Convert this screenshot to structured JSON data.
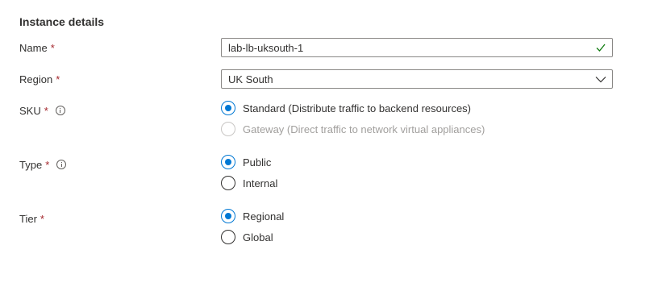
{
  "section": {
    "title": "Instance details"
  },
  "required_marker": "*",
  "name_field": {
    "label": "Name",
    "value": "lab-lb-uksouth-1",
    "valid_icon": "checkmark-icon",
    "valid_color": "#107c10"
  },
  "region_field": {
    "label": "Region",
    "selected": "UK South",
    "icon": "chevron-down-icon"
  },
  "sku_field": {
    "label": "SKU",
    "info_icon": "info-icon",
    "options": [
      {
        "label": "Standard (Distribute traffic to backend resources)",
        "checked": true,
        "disabled": false
      },
      {
        "label": "Gateway (Direct traffic to network virtual appliances)",
        "checked": false,
        "disabled": true
      }
    ]
  },
  "type_field": {
    "label": "Type",
    "info_icon": "info-icon",
    "options": [
      {
        "label": "Public",
        "checked": true,
        "disabled": false
      },
      {
        "label": "Internal",
        "checked": false,
        "disabled": false
      }
    ]
  },
  "tier_field": {
    "label": "Tier",
    "options": [
      {
        "label": "Regional",
        "checked": true,
        "disabled": false
      },
      {
        "label": "Global",
        "checked": false,
        "disabled": false
      }
    ]
  },
  "colors": {
    "accent": "#0078d4",
    "required": "#a4262c",
    "text": "#323130",
    "disabled_text": "#a19f9d",
    "border": "#8a8886"
  }
}
